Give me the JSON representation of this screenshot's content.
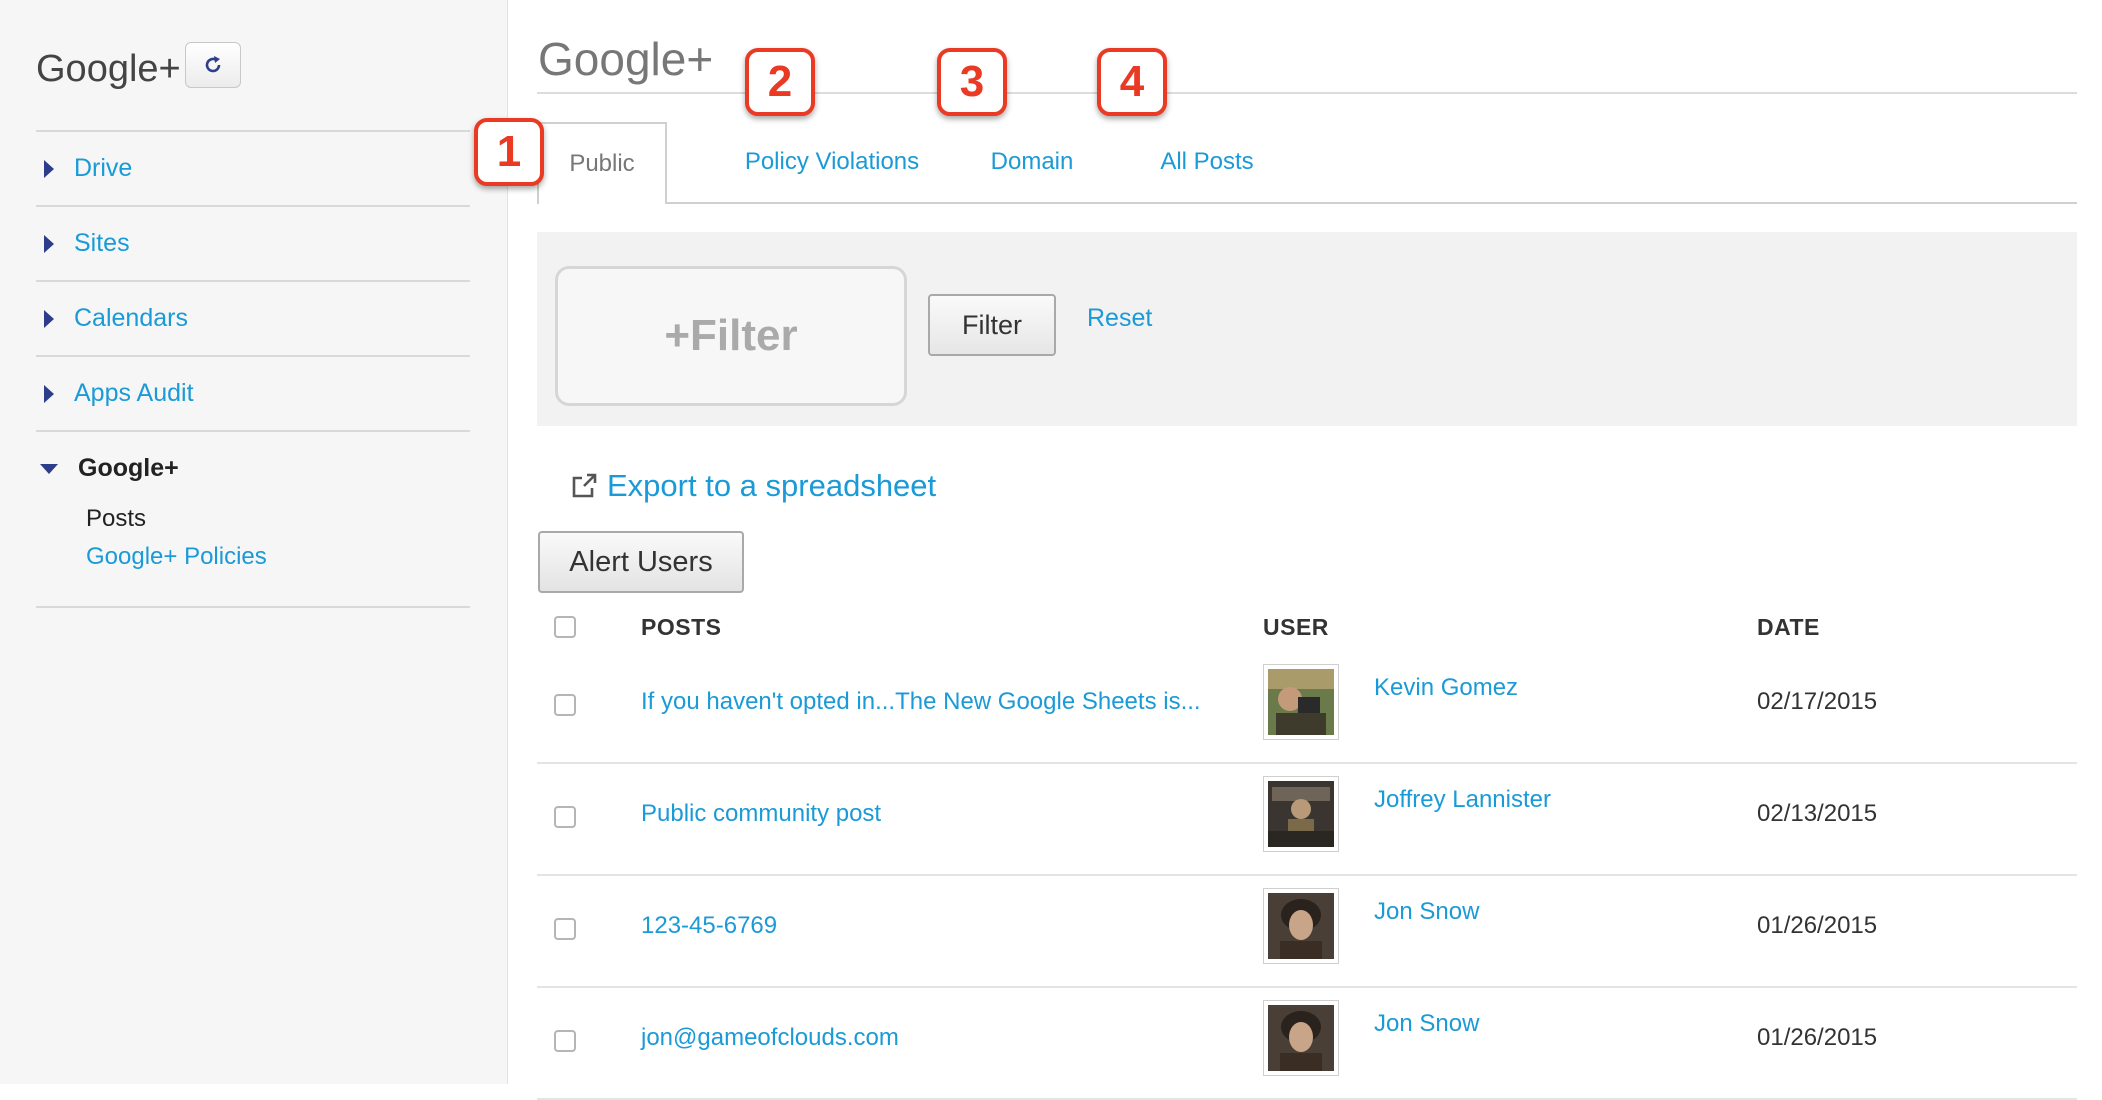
{
  "sidebar": {
    "title": "Google+",
    "refresh_icon": "refresh-icon",
    "items": [
      {
        "label": "Drive"
      },
      {
        "label": "Sites"
      },
      {
        "label": "Calendars"
      },
      {
        "label": "Apps Audit"
      }
    ],
    "open_section": {
      "label": "Google+",
      "subitems": [
        {
          "label": "Posts",
          "current": true
        },
        {
          "label": "Google+ Policies",
          "current": false
        }
      ]
    }
  },
  "main": {
    "title": "Google+",
    "tabs": [
      {
        "label": "Public",
        "active": true
      },
      {
        "label": "Policy Violations",
        "active": false
      },
      {
        "label": "Domain",
        "active": false
      },
      {
        "label": "All Posts",
        "active": false
      }
    ],
    "badges": [
      "1",
      "2",
      "3",
      "4"
    ],
    "filter": {
      "placeholder": "+Filter",
      "button": "Filter",
      "reset": "Reset"
    },
    "export_label": "Export to a spreadsheet",
    "alert_button": "Alert Users",
    "table": {
      "headers": {
        "posts": "POSTS",
        "user": "USER",
        "date": "DATE"
      },
      "rows": [
        {
          "post": "If you haven't opted in...The New Google Sheets is...",
          "user": "Kevin Gomez",
          "date": "02/17/2015"
        },
        {
          "post": "Public community post",
          "user": "Joffrey Lannister",
          "date": "02/13/2015"
        },
        {
          "post": "123-45-6769",
          "user": "Jon Snow",
          "date": "01/26/2015"
        },
        {
          "post": "jon@gameofclouds.com",
          "user": "Jon Snow",
          "date": "01/26/2015"
        }
      ]
    }
  },
  "colors": {
    "link": "#1a9ad6",
    "badge": "#ea3a23",
    "nav_triangle": "#2d3d8a",
    "sidebar_bg": "#f6f6f6"
  }
}
